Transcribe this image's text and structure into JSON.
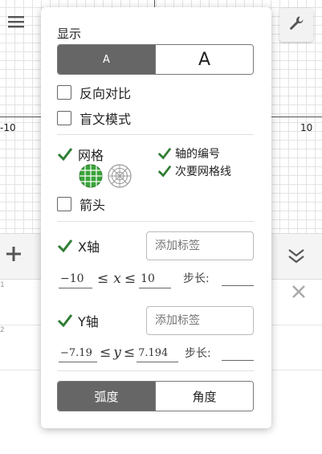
{
  "graph": {
    "x_tick_left": "-10",
    "x_tick_right": "10"
  },
  "toolbar": {
    "menu_icon": "hamburger-icon",
    "settings_icon": "wrench-icon"
  },
  "algebra": {
    "add_icon": "plus-icon",
    "collapse_icon": "double-chevron-down-icon",
    "close_icon": "close-icon",
    "row_index_1": "1",
    "row_index_2": "2"
  },
  "settings": {
    "title": "显示",
    "font_size": {
      "small_label": "A",
      "large_label": "A",
      "selected": "small"
    },
    "reverse_contrast": {
      "label": "反向对比",
      "checked": false
    },
    "screen_reader": {
      "label": "盲文模式",
      "checked": false
    },
    "grid": {
      "label": "网格",
      "checked": true,
      "cartesian_icon": "cartesian-grid-icon",
      "polar_icon": "polar-grid-icon",
      "selected": "cartesian"
    },
    "axis_numbers": {
      "label": "轴的编号",
      "checked": true
    },
    "minor_gridlines": {
      "label": "次要网格线",
      "checked": true
    },
    "arrows": {
      "label": "箭头",
      "checked": false
    },
    "x_axis": {
      "label": "X轴",
      "checked": true,
      "label_placeholder": "添加标签",
      "min": "−10",
      "lte1": "≤",
      "var": "x",
      "lte2": "≤",
      "max": "10",
      "step_label": "步长:",
      "step_value": ""
    },
    "y_axis": {
      "label": "Y轴",
      "checked": true,
      "label_placeholder": "添加标签",
      "min": "−7.19",
      "lte1": "≤",
      "var": "y",
      "lte2": "≤",
      "max": "7.194",
      "step_label": "步长:",
      "step_value": ""
    },
    "angle_unit": {
      "radians_label": "弧度",
      "degrees_label": "角度",
      "selected": "radians"
    }
  },
  "colors": {
    "accent_check": "#2e7d32",
    "grid_icon_green": "#3aa33a",
    "segment_active": "#666666"
  }
}
